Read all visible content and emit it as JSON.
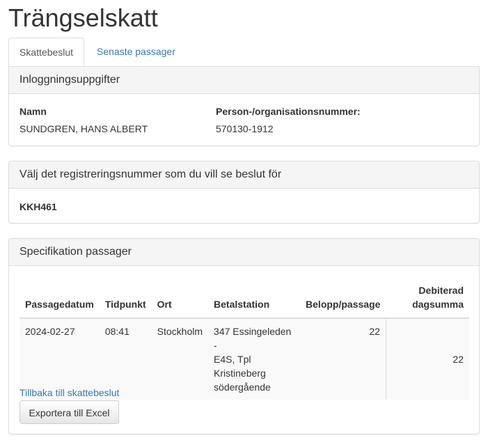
{
  "page": {
    "title": "Trängselskatt"
  },
  "tabs": [
    {
      "label": "Skattebeslut",
      "active": true
    },
    {
      "label": "Senaste passager",
      "active": false
    }
  ],
  "login_panel": {
    "heading": "Inloggningsuppgifter",
    "name_label": "Namn",
    "name_value": "SUNDGREN, HANS ALBERT",
    "id_label": "Person-/organisationsnummer:",
    "id_value": "570130-1912"
  },
  "registration_panel": {
    "heading": "Välj det registreringsnummer som du vill se beslut för",
    "registration_number": "KKH461"
  },
  "passages_panel": {
    "heading": "Specifikation passager",
    "columns": {
      "date": "Passagedatum",
      "time": "Tidpunkt",
      "place": "Ort",
      "station": "Betalstation",
      "amount": "Belopp/passage",
      "day_sum_line1": "Debiterad",
      "day_sum_line2": "dagsumma"
    },
    "rows": [
      {
        "date": "2024-02-27",
        "time": "08:41",
        "place": "Stockholm",
        "station_line1": "347 Essingeleden -",
        "station_line2": "E4S, Tpl Kristineberg",
        "station_line3": "södergående",
        "amount": "22",
        "day_sum": "22"
      }
    ],
    "back_link": "Tillbaka till skattebeslut",
    "export_button": "Exportera till Excel"
  },
  "colors": {
    "link": "#337ab7",
    "panel_heading_bg": "#f5f5f5",
    "border": "#dddddd"
  }
}
